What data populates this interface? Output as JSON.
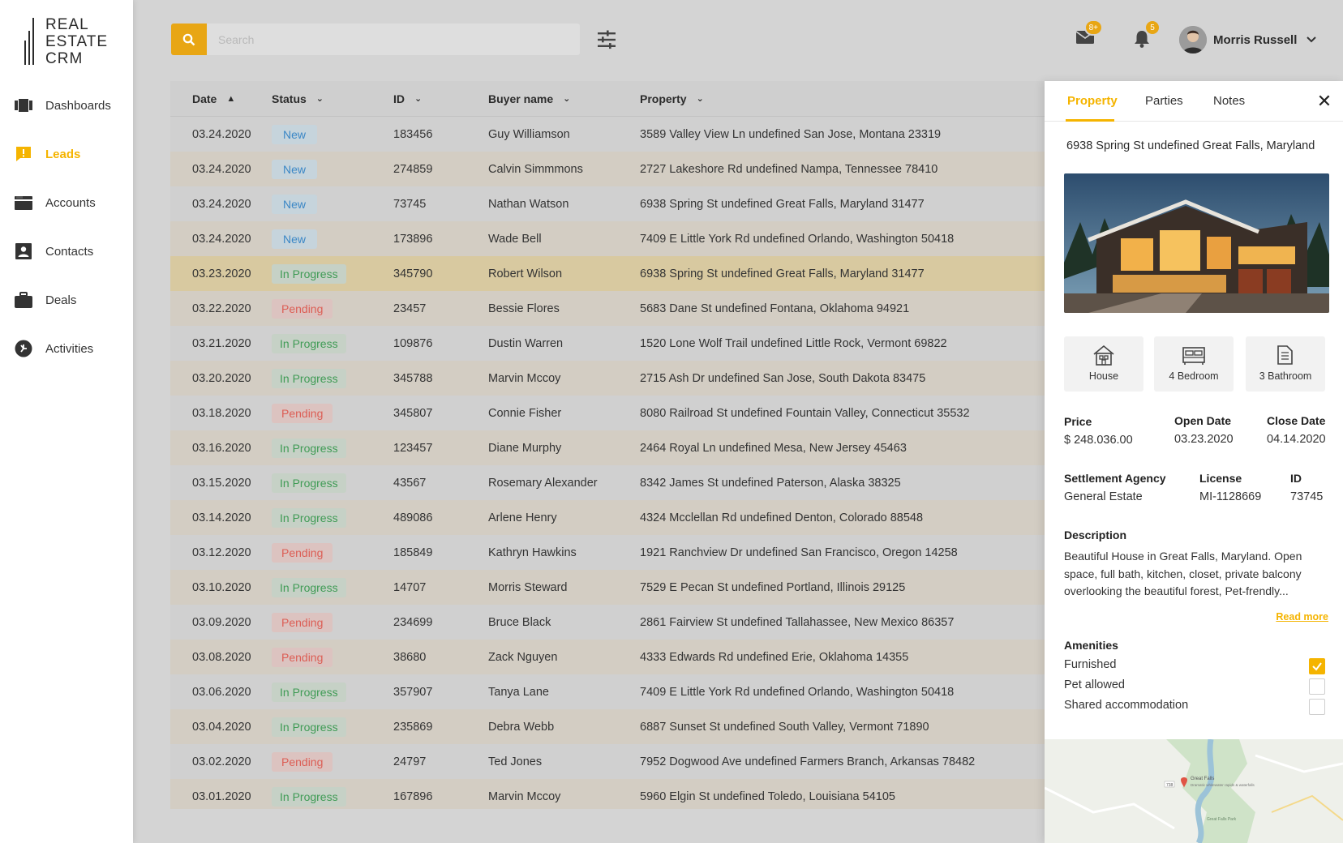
{
  "brand": {
    "line1": "REAL",
    "line2": "ESTATE",
    "line3": "CRM"
  },
  "nav": [
    {
      "label": "Dashboards",
      "icon": "dashboards-icon",
      "active": false
    },
    {
      "label": "Leads",
      "icon": "leads-icon",
      "active": true
    },
    {
      "label": "Accounts",
      "icon": "accounts-icon",
      "active": false
    },
    {
      "label": "Contacts",
      "icon": "contacts-icon",
      "active": false
    },
    {
      "label": "Deals",
      "icon": "deals-icon",
      "active": false
    },
    {
      "label": "Activities",
      "icon": "activities-icon",
      "active": false
    }
  ],
  "search": {
    "placeholder": "Search"
  },
  "notifications": {
    "mail_badge": "8+",
    "bell_badge": "5"
  },
  "user": {
    "name": "Morris Russell"
  },
  "table": {
    "headers": {
      "date": "Date",
      "status": "Status",
      "id": "ID",
      "buyer": "Buyer name",
      "property": "Property"
    },
    "rows": [
      {
        "date": "03.24.2020",
        "status": "New",
        "id": "183456",
        "buyer": "Guy Williamson",
        "property": "3589 Valley View Ln undefined San Jose, Montana 23319"
      },
      {
        "date": "03.24.2020",
        "status": "New",
        "id": "274859",
        "buyer": "Calvin Simmmons",
        "property": "2727 Lakeshore Rd undefined Nampa, Tennessee 78410"
      },
      {
        "date": "03.24.2020",
        "status": "New",
        "id": "73745",
        "buyer": "Nathan Watson",
        "property": "6938 Spring St undefined Great Falls, Maryland 31477"
      },
      {
        "date": "03.24.2020",
        "status": "New",
        "id": "173896",
        "buyer": "Wade Bell",
        "property": "7409 E Little York Rd undefined Orlando, Washington 50418"
      },
      {
        "date": "03.23.2020",
        "status": "In Progress",
        "id": "345790",
        "buyer": "Robert Wilson",
        "property": "6938 Spring St undefined Great Falls, Maryland 31477",
        "selected": true
      },
      {
        "date": "03.22.2020",
        "status": "Pending",
        "id": "23457",
        "buyer": "Bessie Flores",
        "property": "5683 Dane St undefined Fontana, Oklahoma 94921"
      },
      {
        "date": "03.21.2020",
        "status": "In Progress",
        "id": "109876",
        "buyer": "Dustin Warren",
        "property": "1520 Lone Wolf Trail undefined Little Rock, Vermont 69822"
      },
      {
        "date": "03.20.2020",
        "status": "In Progress",
        "id": "345788",
        "buyer": "Marvin Mccoy",
        "property": "2715 Ash Dr undefined San Jose, South Dakota 83475"
      },
      {
        "date": "03.18.2020",
        "status": "Pending",
        "id": "345807",
        "buyer": "Connie Fisher",
        "property": "8080 Railroad St undefined Fountain Valley, Connecticut 35532"
      },
      {
        "date": "03.16.2020",
        "status": "In Progress",
        "id": "123457",
        "buyer": "Diane Murphy",
        "property": "2464 Royal Ln undefined Mesa, New Jersey 45463"
      },
      {
        "date": "03.15.2020",
        "status": "In Progress",
        "id": "43567",
        "buyer": "Rosemary Alexander",
        "property": "8342 James St undefined Paterson, Alaska 38325"
      },
      {
        "date": "03.14.2020",
        "status": "In Progress",
        "id": "489086",
        "buyer": "Arlene Henry",
        "property": "4324 Mcclellan Rd undefined Denton, Colorado 88548"
      },
      {
        "date": "03.12.2020",
        "status": "Pending",
        "id": "185849",
        "buyer": "Kathryn Hawkins",
        "property": "1921 Ranchview Dr undefined San Francisco, Oregon 14258"
      },
      {
        "date": "03.10.2020",
        "status": "In Progress",
        "id": "14707",
        "buyer": "Morris Steward",
        "property": "7529 E Pecan St undefined Portland, Illinois 29125"
      },
      {
        "date": "03.09.2020",
        "status": "Pending",
        "id": "234699",
        "buyer": "Bruce Black",
        "property": "2861 Fairview St undefined Tallahassee, New Mexico 86357"
      },
      {
        "date": "03.08.2020",
        "status": "Pending",
        "id": "38680",
        "buyer": "Zack Nguyen",
        "property": "4333 Edwards Rd undefined Erie, Oklahoma 14355"
      },
      {
        "date": "03.06.2020",
        "status": "In Progress",
        "id": "357907",
        "buyer": "Tanya Lane",
        "property": "7409 E Little York Rd undefined Orlando, Washington 50418"
      },
      {
        "date": "03.04.2020",
        "status": "In Progress",
        "id": "235869",
        "buyer": "Debra Webb",
        "property": "6887 Sunset St undefined South Valley, Vermont 71890"
      },
      {
        "date": "03.02.2020",
        "status": "Pending",
        "id": "24797",
        "buyer": "Ted Jones",
        "property": "7952 Dogwood Ave undefined Farmers Branch, Arkansas 78482"
      },
      {
        "date": "03.01.2020",
        "status": "In Progress",
        "id": "167896",
        "buyer": "Marvin Mccoy",
        "property": "5960 Elgin St undefined Toledo, Louisiana 54105"
      }
    ]
  },
  "panel": {
    "tabs": {
      "property": "Property",
      "parties": "Parties",
      "notes": "Notes"
    },
    "address": "6938 Spring St undefined Great Falls, Maryland",
    "features": {
      "type": "House",
      "bedrooms": "4 Bedroom",
      "bathrooms": "3 Bathroom"
    },
    "price_label": "Price",
    "price": "$ 248.036.00",
    "open_label": "Open Date",
    "open_date": "03.23.2020",
    "close_label": "Close Date",
    "close_date": "04.14.2020",
    "agency_label": "Settlement Agency",
    "agency": "General Estate",
    "license_label": "License",
    "license": "MI-1128669",
    "id_label": "ID",
    "id": "73745",
    "description_label": "Description",
    "description": "Beautiful House in Great Falls, Maryland. Open space, full bath, kitchen, closet, private balcony overlooking the beautiful forest, Pet-frendly...",
    "read_more": "Read more",
    "amenities_label": "Amenities",
    "amenities": [
      {
        "label": "Furnished",
        "checked": true
      },
      {
        "label": "Pet allowed",
        "checked": false
      },
      {
        "label": "Shared accommodation",
        "checked": false
      }
    ],
    "map_labels": {
      "poi": "Great Falls",
      "poi_sub": "Dramatic whitewater rapids & waterfalls",
      "park": "Great Falls Park",
      "road": "738"
    }
  },
  "colors": {
    "accent": "#f5b400",
    "search_button": "#e8a614",
    "new": "#3b87c6",
    "in_progress": "#3f9b55",
    "pending": "#dc5e55"
  }
}
